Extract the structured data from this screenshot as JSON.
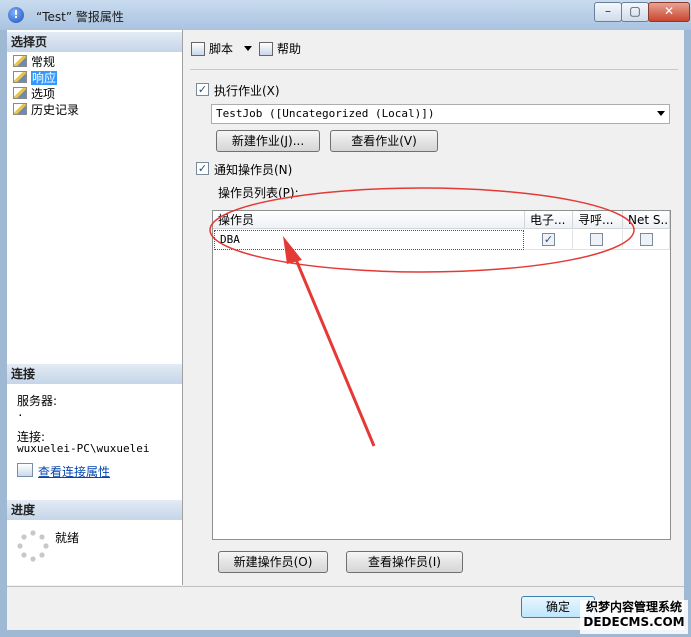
{
  "window": {
    "title": "“Test” 警报属性",
    "min": "–",
    "max": "▢",
    "close": "✕",
    "info_glyph": "!"
  },
  "left": {
    "select_page_header": "选择页",
    "pages": [
      {
        "label": "常规",
        "icon": "page-icon"
      },
      {
        "label": "响应",
        "icon": "page-icon",
        "selected": true
      },
      {
        "label": "选项",
        "icon": "page-icon"
      },
      {
        "label": "历史记录",
        "icon": "page-icon"
      }
    ],
    "connection_header": "连接",
    "server_label": "服务器:",
    "server_value": ".",
    "connection_label": "连接:",
    "connection_value": "wuxuelei-PC\\wuxuelei",
    "view_connection_link": "查看连接属性",
    "progress_header": "进度",
    "progress_status": "就绪"
  },
  "toolbar": {
    "script_label": "脚本",
    "help_label": "帮助"
  },
  "response": {
    "execute_job": {
      "label": "执行作业(X)",
      "checked": true
    },
    "job_value": "TestJob ([Uncategorized (Local)])",
    "new_job_button": "新建作业(J)...",
    "view_job_button": "查看作业(V)",
    "notify_operators": {
      "label": "通知操作员(N)",
      "checked": true
    },
    "operator_list_label": "操作员列表(P):",
    "grid": {
      "columns": [
        "操作员",
        "电子...",
        "寻呼...",
        "Net S..."
      ],
      "rows": [
        {
          "operator": "DBA",
          "email": true,
          "pager": false,
          "netsend": false
        }
      ]
    },
    "new_operator_button": "新建操作员(O)",
    "view_operator_button": "查看操作员(I)"
  },
  "footer": {
    "ok_button": "确定",
    "watermark_line1": "织梦内容管理系统",
    "watermark_line2": "DEDECMS.COM"
  },
  "colors": {
    "annotation": "#e53935",
    "selection": "#3399ff",
    "header_bg": "#c5d5e8"
  }
}
